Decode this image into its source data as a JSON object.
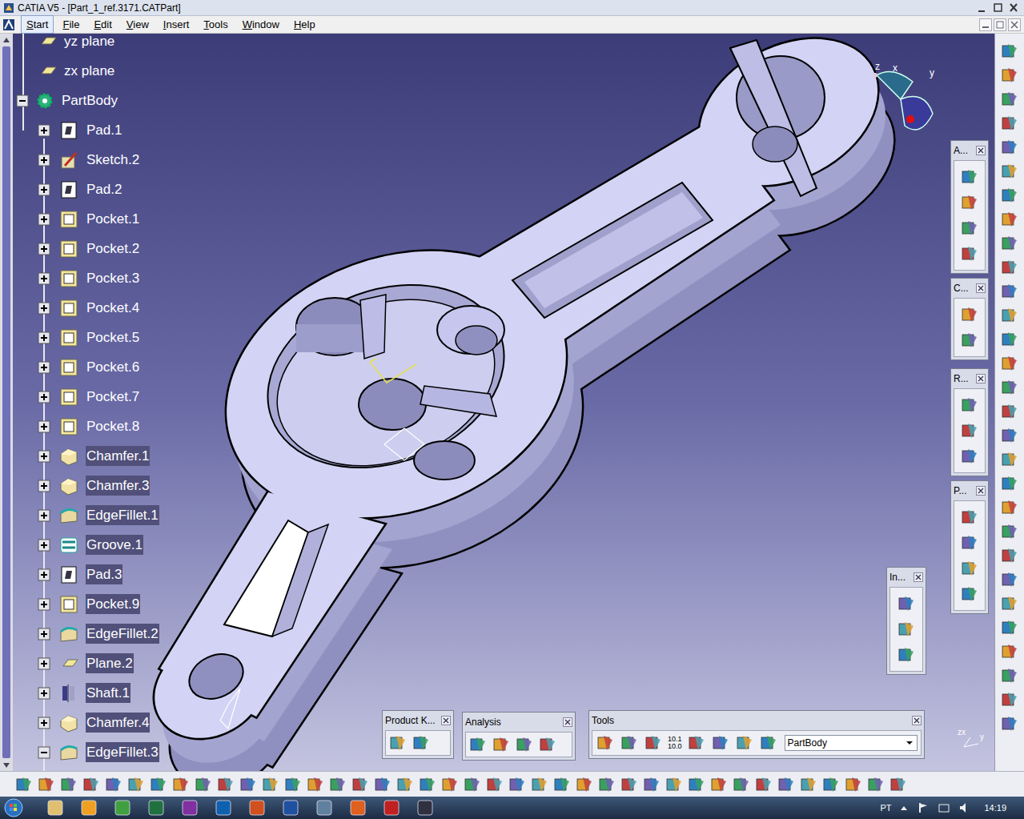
{
  "window": {
    "title": "CATIA V5 - [Part_1_ref.3171.CATPart]"
  },
  "menu": [
    {
      "label": "Start",
      "selected": true
    },
    {
      "label": "File",
      "selected": false
    },
    {
      "label": "Edit",
      "selected": false
    },
    {
      "label": "View",
      "selected": false
    },
    {
      "label": "Insert",
      "selected": false
    },
    {
      "label": "Tools",
      "selected": false
    },
    {
      "label": "Window",
      "selected": false
    },
    {
      "label": "Help",
      "selected": false
    }
  ],
  "tree": {
    "planes": [
      {
        "label": "yz plane",
        "kind": "plane"
      },
      {
        "label": "zx plane",
        "kind": "plane"
      }
    ],
    "body": {
      "label": "PartBody",
      "kind": "body",
      "expanded": true,
      "children": [
        {
          "label": "Pad.1",
          "kind": "pad",
          "expanded": false,
          "highlighted": false
        },
        {
          "label": "Sketch.2",
          "kind": "sketch",
          "expanded": false,
          "highlighted": false
        },
        {
          "label": "Pad.2",
          "kind": "pad",
          "expanded": false,
          "highlighted": false
        },
        {
          "label": "Pocket.1",
          "kind": "pocket",
          "expanded": false,
          "highlighted": false
        },
        {
          "label": "Pocket.2",
          "kind": "pocket",
          "expanded": false,
          "highlighted": false
        },
        {
          "label": "Pocket.3",
          "kind": "pocket",
          "expanded": false,
          "highlighted": false
        },
        {
          "label": "Pocket.4",
          "kind": "pocket",
          "expanded": false,
          "highlighted": false
        },
        {
          "label": "Pocket.5",
          "kind": "pocket",
          "expanded": false,
          "highlighted": false
        },
        {
          "label": "Pocket.6",
          "kind": "pocket",
          "expanded": false,
          "highlighted": false
        },
        {
          "label": "Pocket.7",
          "kind": "pocket",
          "expanded": false,
          "highlighted": false
        },
        {
          "label": "Pocket.8",
          "kind": "pocket",
          "expanded": false,
          "highlighted": false
        },
        {
          "label": "Chamfer.1",
          "kind": "chamfer",
          "expanded": false,
          "highlighted": true
        },
        {
          "label": "Chamfer.3",
          "kind": "chamfer",
          "expanded": false,
          "highlighted": true
        },
        {
          "label": "EdgeFillet.1",
          "kind": "fillet",
          "expanded": false,
          "highlighted": true
        },
        {
          "label": "Groove.1",
          "kind": "groove",
          "expanded": false,
          "highlighted": true
        },
        {
          "label": "Pad.3",
          "kind": "pad",
          "expanded": false,
          "highlighted": true
        },
        {
          "label": "Pocket.9",
          "kind": "pocket",
          "expanded": false,
          "highlighted": true
        },
        {
          "label": "EdgeFillet.2",
          "kind": "fillet",
          "expanded": false,
          "highlighted": true
        },
        {
          "label": "Plane.2",
          "kind": "plane",
          "expanded": false,
          "highlighted": true
        },
        {
          "label": "Shaft.1",
          "kind": "shaft",
          "expanded": false,
          "highlighted": true
        },
        {
          "label": "Chamfer.4",
          "kind": "chamfer",
          "expanded": false,
          "highlighted": true
        },
        {
          "label": "EdgeFillet.3",
          "kind": "fillet",
          "expanded": true,
          "highlighted": true
        }
      ]
    }
  },
  "compass": {
    "labels": [
      "z",
      "x",
      "y"
    ]
  },
  "corner_axis": {
    "labels": [
      "zx",
      "y"
    ]
  },
  "floating_toolbars": [
    {
      "title": "A..."
    },
    {
      "title": "C..."
    },
    {
      "title": "R..."
    },
    {
      "title": "P..."
    },
    {
      "title": "In..."
    },
    {
      "title": "Product K..."
    },
    {
      "title": "Analysis"
    }
  ],
  "tools_toolbar": {
    "title": "Tools",
    "icon_labels": [
      "10.1",
      "10.0"
    ],
    "combo": "PartBody"
  },
  "taskbar": {
    "language": "PT",
    "time": "14:19"
  }
}
